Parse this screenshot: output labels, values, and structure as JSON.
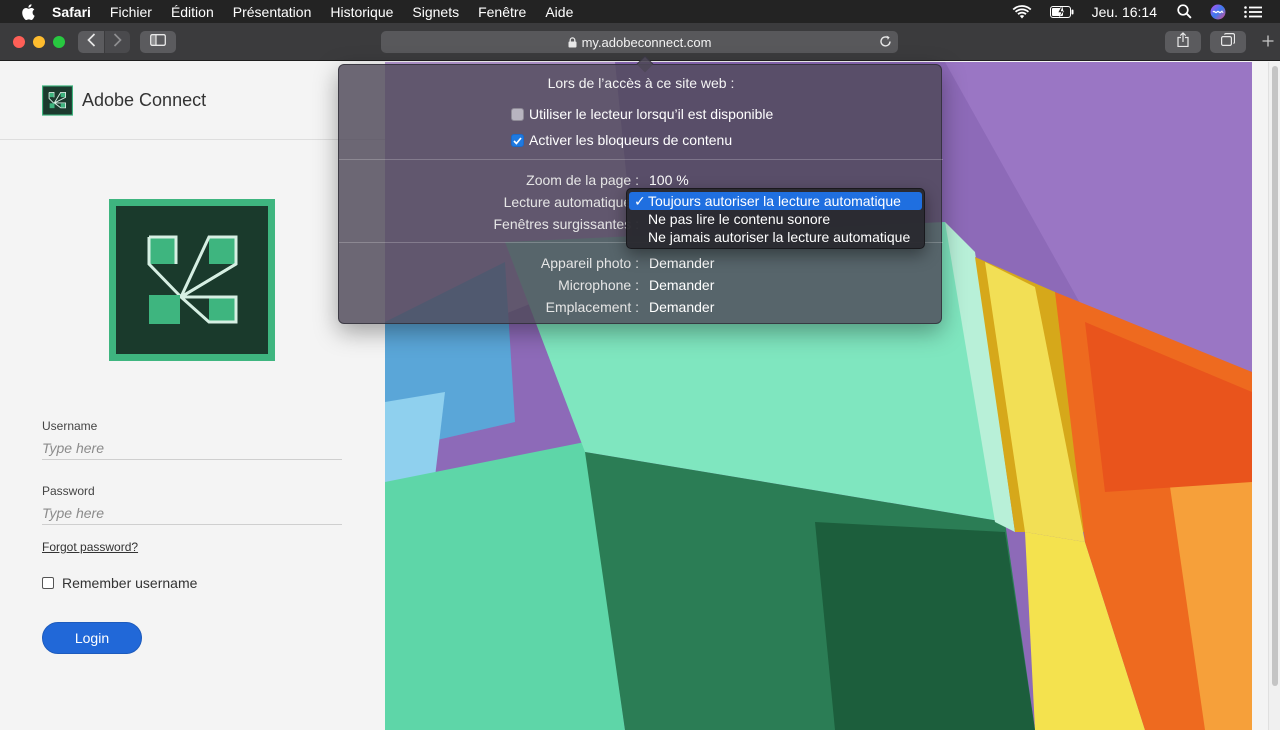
{
  "menubar": {
    "app_name": "Safari",
    "items": [
      "Fichier",
      "Édition",
      "Présentation",
      "Historique",
      "Signets",
      "Fenêtre",
      "Aide"
    ],
    "clock": "Jeu. 16:14"
  },
  "toolbar": {
    "url": "my.adobeconnect.com"
  },
  "left_panel": {
    "brand_name": "Adobe Connect",
    "username_label": "Username",
    "username_placeholder": "Type here",
    "password_label": "Password",
    "password_placeholder": "Type here",
    "forgot_password": "Forgot password?",
    "remember_username": "Remember username",
    "login_button": "Login"
  },
  "popover": {
    "title": "Lors de l’accès à ce site web :",
    "reader_option": "Utiliser le lecteur lorsqu’il est disponible",
    "reader_checked": false,
    "content_blockers_option": "Activer les bloqueurs de contenu",
    "content_blockers_checked": true,
    "zoom_label": "Zoom de la page :",
    "zoom_value": "100 %",
    "autoplay_label": "Lecture automatique :",
    "popups_label": "Fenêtres surgissantes :",
    "camera_label": "Appareil photo :",
    "camera_value": "Demander",
    "microphone_label": "Microphone :",
    "microphone_value": "Demander",
    "location_label": "Emplacement :",
    "location_value": "Demander"
  },
  "autoplay_menu": {
    "options": [
      "Toujours autoriser la lecture automatique",
      "Ne pas lire le contenu sonore",
      "Ne jamais autoriser la lecture automatique"
    ],
    "selected_index": 0,
    "check_glyph": "✓"
  },
  "colors": {
    "login_blue": "#2168d8",
    "adobe_connect_green": "#3eb57f",
    "selection_blue": "#1f6fe0"
  }
}
